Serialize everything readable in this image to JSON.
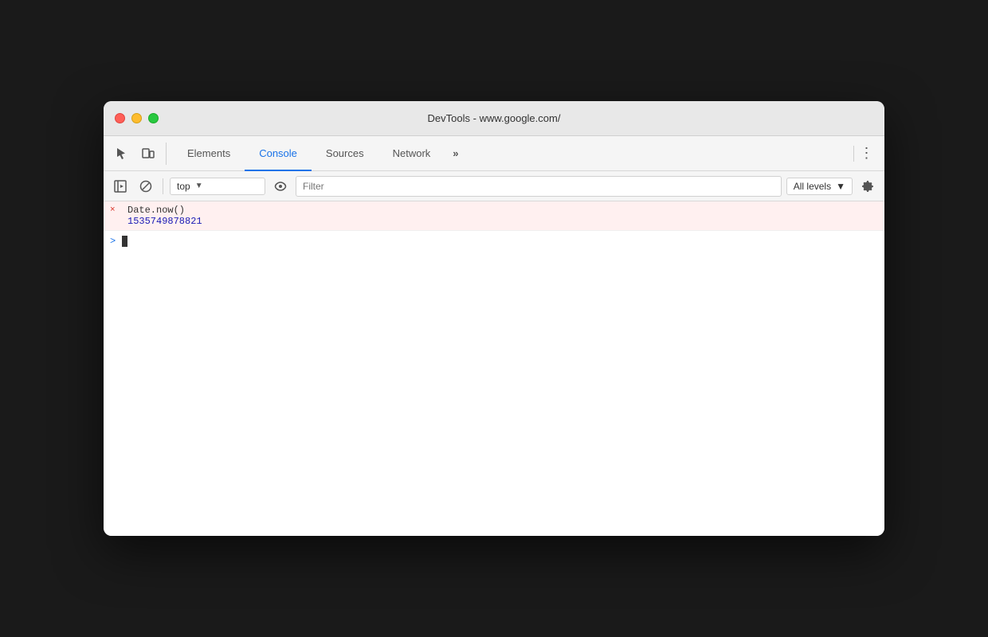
{
  "window": {
    "title": "DevTools - www.google.com/",
    "traffic_lights": {
      "close_label": "close",
      "minimize_label": "minimize",
      "maximize_label": "maximize"
    }
  },
  "tabbar": {
    "tabs": [
      {
        "id": "elements",
        "label": "Elements",
        "active": false
      },
      {
        "id": "console",
        "label": "Console",
        "active": true
      },
      {
        "id": "sources",
        "label": "Sources",
        "active": false
      },
      {
        "id": "network",
        "label": "Network",
        "active": false
      }
    ],
    "more_label": "»",
    "kebab_label": "⋮"
  },
  "console_toolbar": {
    "context_value": "top",
    "context_arrow": "▼",
    "filter_placeholder": "Filter",
    "levels_label": "All levels",
    "levels_arrow": "▼"
  },
  "console": {
    "entries": [
      {
        "type": "error",
        "icon": "×",
        "text": "Date.now()",
        "value": "1535749878821"
      }
    ],
    "prompt_arrow": ">"
  }
}
